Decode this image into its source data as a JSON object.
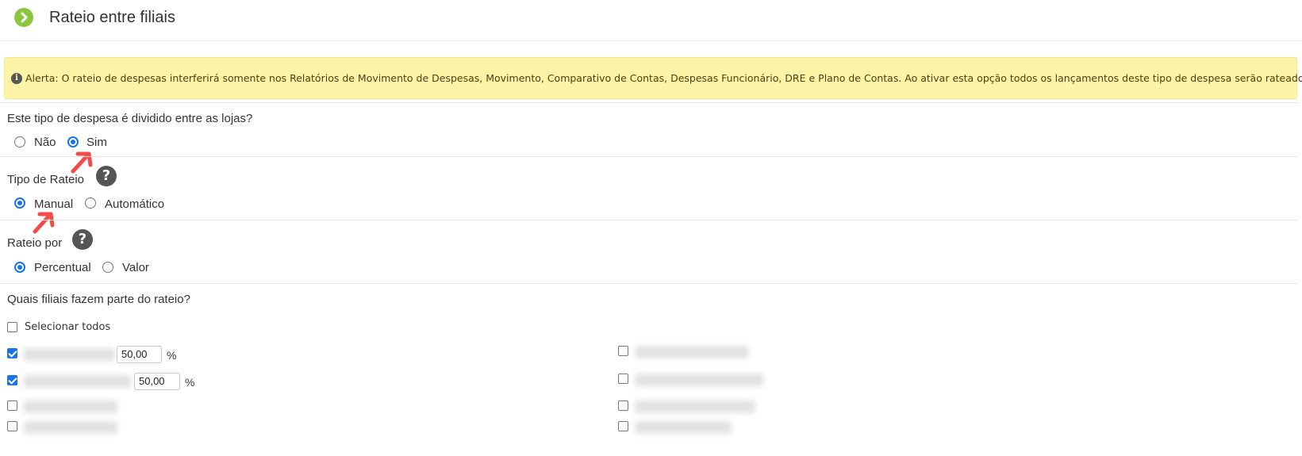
{
  "header": {
    "title": "Rateio entre filiais",
    "icon": "chevron-right-circle-icon",
    "icon_color": "#8cc63f"
  },
  "alert": {
    "text": "Alerta: O rateio de despesas interferirá somente nos Relatórios de Movimento de Despesas, Movimento, Comparativo de Contas, Despesas Funcionário, DRE e Plano de Contas. Ao ativar esta opção todos os lançamentos deste tipo de despesa serão rateados.",
    "background": "#fcf5a8",
    "icon": "info-icon"
  },
  "dividido": {
    "question": "Este tipo de despesa é dividido entre as lojas?",
    "options": [
      {
        "label": "Não",
        "checked": false
      },
      {
        "label": "Sim",
        "checked": true
      }
    ]
  },
  "tipo_rateio": {
    "question": "Tipo de Rateio",
    "help_icon": "question-circle-icon",
    "options": [
      {
        "label": "Manual",
        "checked": true
      },
      {
        "label": "Automático",
        "checked": false
      }
    ]
  },
  "rateio_por": {
    "question": "Rateio por",
    "help_icon": "question-circle-icon",
    "options": [
      {
        "label": "Percentual",
        "checked": true
      },
      {
        "label": "Valor",
        "checked": false
      }
    ]
  },
  "filiais": {
    "question": "Quais filiais fazem parte do rateio?",
    "select_all_label": "Selecionar todos",
    "select_all_checked": false,
    "percent_sign": "%",
    "left": [
      {
        "checked": true,
        "value": "50,00"
      },
      {
        "checked": true,
        "value": "50,00"
      },
      {
        "checked": false
      },
      {
        "checked": false
      }
    ],
    "right": [
      {
        "checked": false
      },
      {
        "checked": false
      },
      {
        "checked": false
      },
      {
        "checked": false
      }
    ]
  },
  "colors": {
    "accent": "#1a73e8",
    "annotation_arrow": "#f44a4a"
  }
}
